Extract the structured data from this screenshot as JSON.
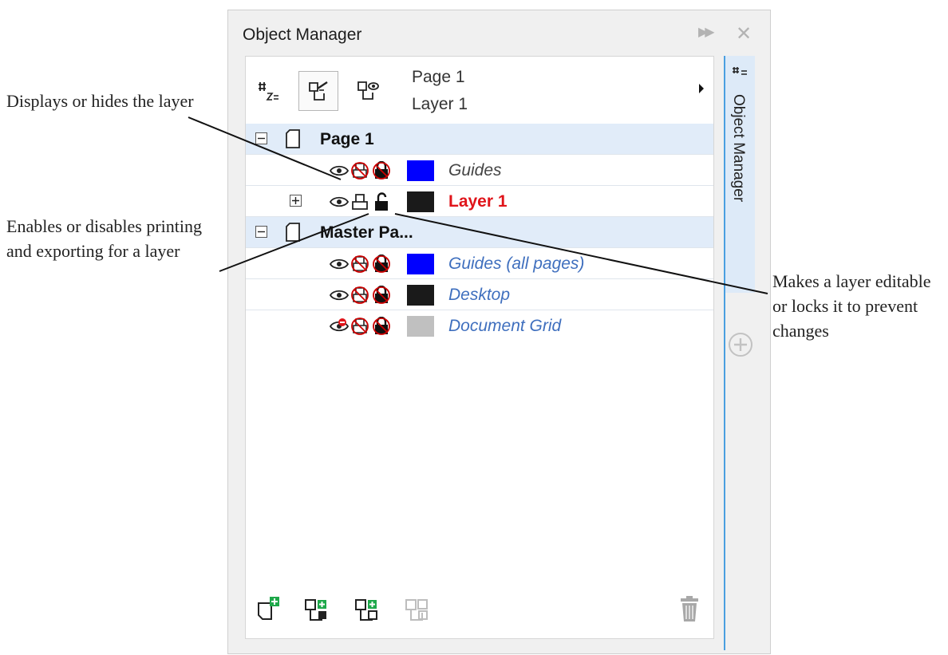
{
  "callouts": {
    "visibility": "Displays or hides the layer",
    "print": "Enables or disables printing and exporting for a layer",
    "lock": "Makes a layer editable or locks it to prevent changes"
  },
  "panel": {
    "title": "Object Manager",
    "expand_glyph": "▶▶",
    "close_glyph": "✕"
  },
  "toolbar": {
    "current_page": "Page 1",
    "current_layer": "Layer 1",
    "buttons": [
      "page-tree-icon",
      "layer-manager-icon",
      "master-page-icon"
    ]
  },
  "tree": {
    "page1": {
      "label": "Page 1",
      "expanded": true
    },
    "page1_guides": {
      "label": "Guides",
      "visible": true,
      "printable": false,
      "locked": true,
      "color": "#0000ff"
    },
    "layer1": {
      "label": "Layer 1",
      "visible": true,
      "printable": true,
      "locked": false,
      "color": "#1a1a1a",
      "active": true
    },
    "master": {
      "label": "Master Pa...",
      "expanded": true
    },
    "guides_all": {
      "label": "Guides (all pages)",
      "visible": true,
      "printable": false,
      "locked": true,
      "color": "#0000ff"
    },
    "desktop": {
      "label": "Desktop",
      "visible": true,
      "printable": false,
      "locked": true,
      "color": "#1a1a1a"
    },
    "document_grid": {
      "label": "Document Grid",
      "visible": false,
      "printable": false,
      "locked": true,
      "color": "#c0c0c0"
    }
  },
  "bottom_bar": {
    "buttons": [
      "new-layer-icon",
      "new-master-layer-all-pages-icon",
      "new-master-layer-icon",
      "new-master-layer-disabled-icon",
      "delete-icon"
    ]
  },
  "docker": {
    "tab_label": "Object Manager",
    "accent": "#4a9fe0"
  },
  "colors": {
    "selected_row": "#e1ecf9",
    "active_layer_text": "#e0141a",
    "master_layer_text": "#3f6fbe",
    "disabled_icon": "#cc0000",
    "add_green": "#1ea84a"
  }
}
